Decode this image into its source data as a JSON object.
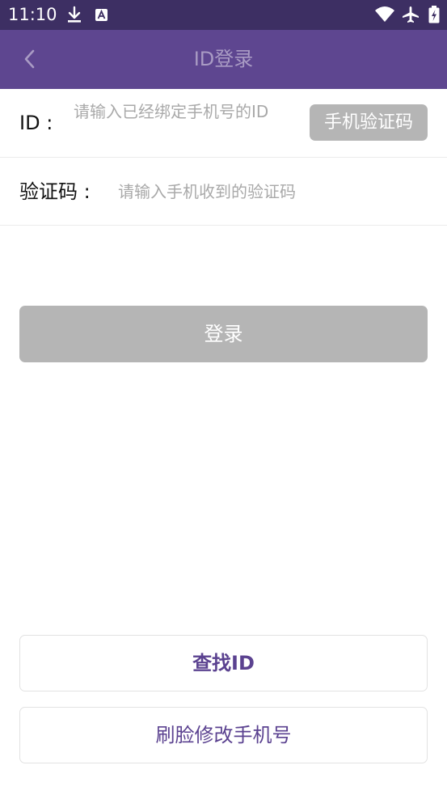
{
  "status_bar": {
    "time": "11:10",
    "left_icons": [
      "download-icon",
      "app-notification-icon"
    ],
    "right_icons": [
      "wifi-icon",
      "airplane-mode-icon",
      "battery-charging-icon"
    ]
  },
  "app_bar": {
    "back_icon": "chevron-left-icon",
    "title": "ID登录"
  },
  "id_row": {
    "label": "ID :",
    "placeholder": "请输入已经绑定手机号的ID",
    "value": "",
    "sms_button_label": "手机验证码"
  },
  "code_row": {
    "label": "验证码 :",
    "placeholder": "请输入手机收到的验证码",
    "value": ""
  },
  "login_button": {
    "label": "登录"
  },
  "bottom_actions": {
    "find_id_label": "查找ID",
    "face_change_phone_label": "刷脸修改手机号"
  },
  "colors": {
    "status_bar": "#3d2f63",
    "app_bar": "#5e4690",
    "title_text": "#a99bc4",
    "disabled_button": "#b5b5b5",
    "accent_text": "#5b4290"
  }
}
